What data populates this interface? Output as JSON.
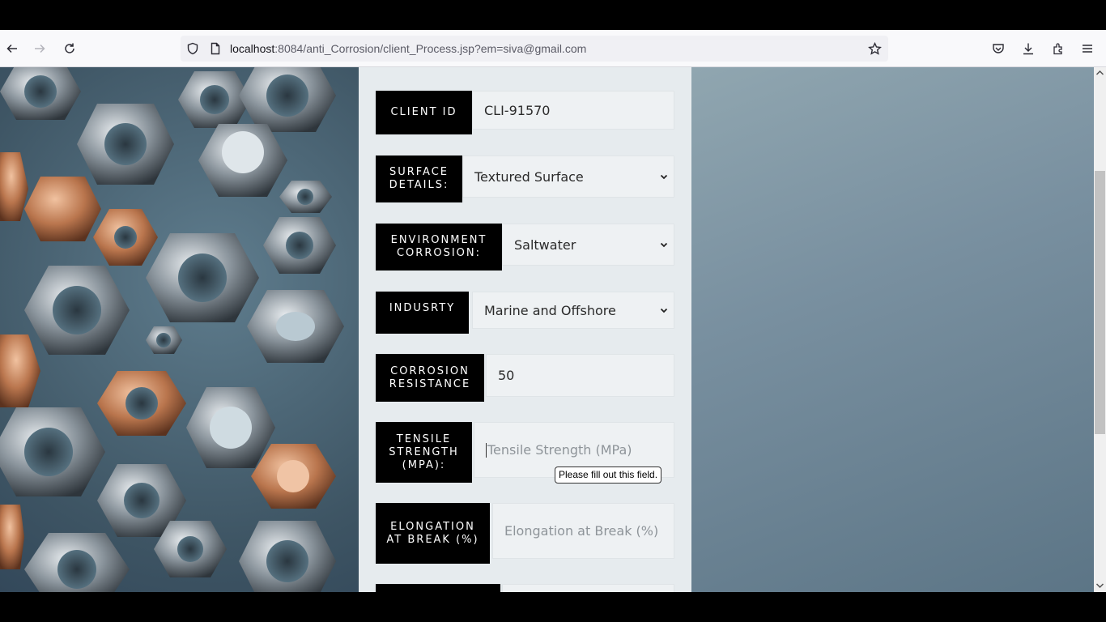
{
  "browser": {
    "url_host": "localhost",
    "url_rest": ":8084/anti_Corrosion/client_Process.jsp?em=siva@gmail.com"
  },
  "form": {
    "client_id": {
      "label": "CLIENT ID",
      "value": "CLI-91570"
    },
    "surface": {
      "label": "SURFACE DETAILS:",
      "value": "Textured Surface"
    },
    "environment": {
      "label": "ENVIRONMENT CORROSION:",
      "value": "Saltwater"
    },
    "industry": {
      "label": "INDUSRTY",
      "value": "Marine and Offshore"
    },
    "corrosion_resistance": {
      "label": "CORROSION RESISTANCE",
      "value": "50"
    },
    "tensile": {
      "label": "TENSILE STRENGTH (MPA):",
      "placeholder": "Tensile Strength (MPa)"
    },
    "elongation": {
      "label": "ELONGATION AT BREAK (%)",
      "placeholder": "Elongation at Break (%)"
    }
  },
  "tooltip": "Please fill out this field.",
  "icons": {
    "back": "arrow-left-icon",
    "forward": "arrow-right-icon",
    "reload": "reload-icon",
    "shield": "shield-icon",
    "page": "page-icon",
    "star": "star-icon",
    "pocket": "pocket-icon",
    "download": "download-icon",
    "extensions": "extensions-icon",
    "menu": "hamburger-menu-icon"
  }
}
